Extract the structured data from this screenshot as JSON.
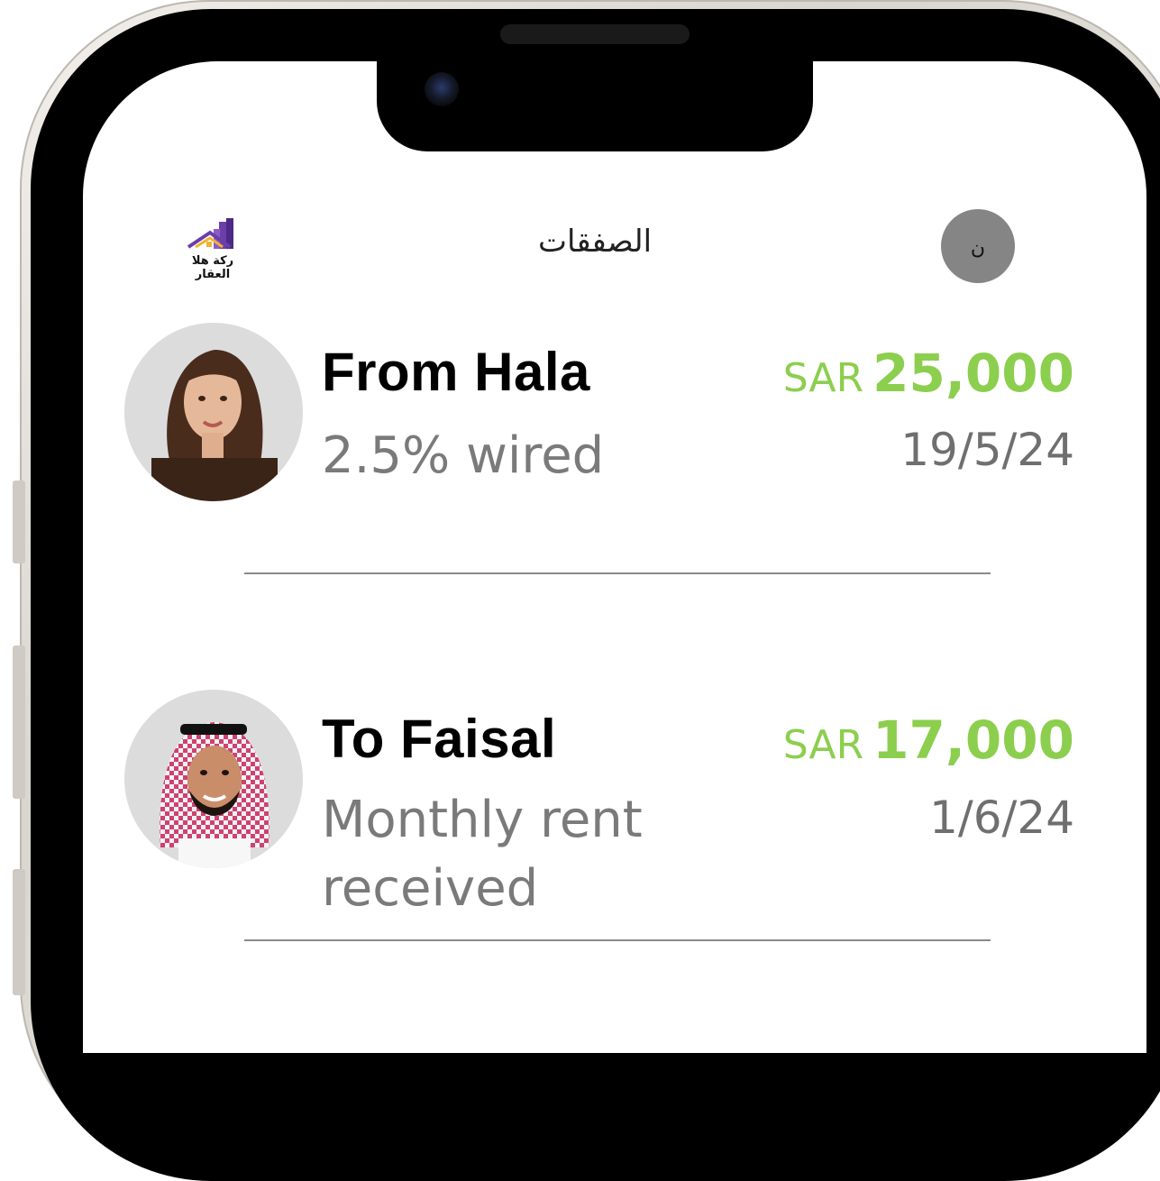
{
  "header": {
    "title": "الصفقات",
    "logo_text": "ركة هلا العقار",
    "user_initial": "ن"
  },
  "transactions": [
    {
      "name": "From Hala",
      "description": "2.5% wired",
      "currency": "SAR",
      "amount": "25,000",
      "date": "19/5/24",
      "avatar_icon": "woman-portrait"
    },
    {
      "name": "To Faisal",
      "description": "Monthly rent received",
      "currency": "SAR",
      "amount": "17,000",
      "date": "1/6/24",
      "avatar_icon": "man-portrait-shemagh"
    }
  ],
  "colors": {
    "amount": "#8cce4e",
    "avatar_button": "#858585",
    "divider": "#8a8a8a"
  }
}
